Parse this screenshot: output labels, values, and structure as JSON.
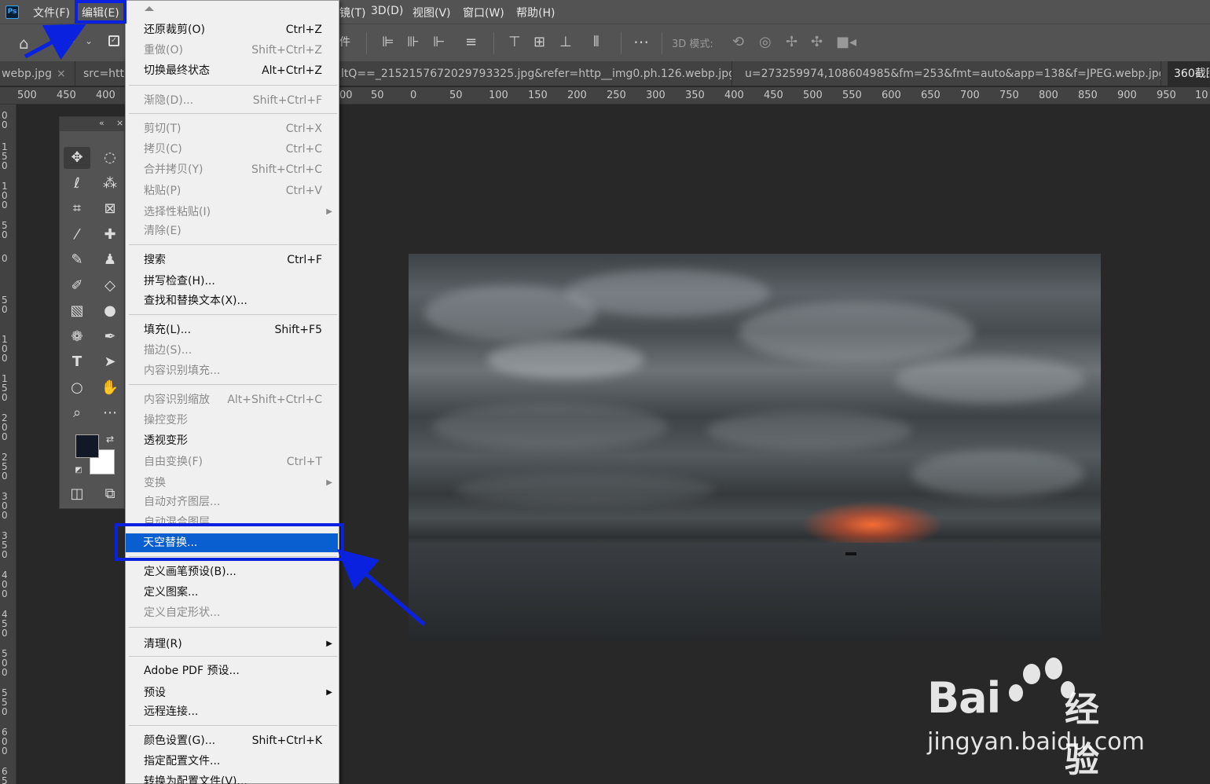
{
  "app": {
    "logo": "Ps"
  },
  "menubar": {
    "items": [
      {
        "label": "文件(F)"
      },
      {
        "label": "编辑(E)"
      },
      {
        "label": "镜(T)"
      },
      {
        "label": "3D(D)"
      },
      {
        "label": "视图(V)"
      },
      {
        "label": "窗口(W)"
      },
      {
        "label": "帮助(H)"
      }
    ]
  },
  "options": {
    "threed_label": "3D 模式:",
    "partial_label": "件"
  },
  "tabs": [
    {
      "label": "webp.jpg"
    },
    {
      "label": "src=http"
    },
    {
      "label": "ltQ==_2152157672029793325.jpg&refer=http__img0.ph.126.webp.jpg"
    },
    {
      "label": "u=273259974,108604985&fm=253&fmt=auto&app=138&f=JPEG.webp.jpg"
    },
    {
      "label": "360截图"
    }
  ],
  "tab_close": "×",
  "ruler": {
    "left_ticks": [
      "500",
      "450",
      "400"
    ],
    "right_ticks": [
      "00",
      "50",
      "0",
      "50",
      "100",
      "150",
      "200",
      "250",
      "300",
      "350",
      "400",
      "450",
      "500",
      "550",
      "600",
      "650",
      "700",
      "750",
      "800",
      "850",
      "900",
      "950",
      "10"
    ],
    "vertical_labels": [
      "0 0",
      "1 5 0",
      "1 0 0",
      "5 0",
      "0",
      "5 0",
      "1 0 0",
      "1 5 0",
      "2 0 0",
      "2 5 0",
      "3 0 0",
      "3 5 0",
      "4 0 0",
      "4 5 0",
      "5 0 0",
      "5 5 0",
      "6 0 0",
      "6 5"
    ]
  },
  "edit_menu": {
    "items": [
      {
        "label": "还原裁剪(O)",
        "shortcut": "Ctrl+Z",
        "disabled": false
      },
      {
        "label": "重做(O)",
        "shortcut": "Shift+Ctrl+Z",
        "disabled": true
      },
      {
        "label": "切换最终状态",
        "shortcut": "Alt+Ctrl+Z",
        "disabled": false
      },
      {
        "label": "渐隐(D)...",
        "shortcut": "Shift+Ctrl+F",
        "disabled": true
      },
      {
        "label": "剪切(T)",
        "shortcut": "Ctrl+X",
        "disabled": true
      },
      {
        "label": "拷贝(C)",
        "shortcut": "Ctrl+C",
        "disabled": true
      },
      {
        "label": "合并拷贝(Y)",
        "shortcut": "Shift+Ctrl+C",
        "disabled": true
      },
      {
        "label": "粘贴(P)",
        "shortcut": "Ctrl+V",
        "disabled": true
      },
      {
        "label": "选择性粘贴(I)",
        "shortcut": "",
        "disabled": true,
        "submenu": true
      },
      {
        "label": "清除(E)",
        "shortcut": "",
        "disabled": true
      },
      {
        "label": "搜索",
        "shortcut": "Ctrl+F",
        "disabled": false
      },
      {
        "label": "拼写检查(H)...",
        "shortcut": "",
        "disabled": false
      },
      {
        "label": "查找和替换文本(X)...",
        "shortcut": "",
        "disabled": false
      },
      {
        "label": "填充(L)...",
        "shortcut": "Shift+F5",
        "disabled": false
      },
      {
        "label": "描边(S)...",
        "shortcut": "",
        "disabled": true
      },
      {
        "label": "内容识别填充...",
        "shortcut": "",
        "disabled": true
      },
      {
        "label": "内容识别缩放",
        "shortcut": "Alt+Shift+Ctrl+C",
        "disabled": true
      },
      {
        "label": "操控变形",
        "shortcut": "",
        "disabled": true
      },
      {
        "label": "透视变形",
        "shortcut": "",
        "disabled": false
      },
      {
        "label": "自由变换(F)",
        "shortcut": "Ctrl+T",
        "disabled": true
      },
      {
        "label": "变换",
        "shortcut": "",
        "disabled": true,
        "submenu": true
      },
      {
        "label": "自动对齐图层...",
        "shortcut": "",
        "disabled": true
      },
      {
        "label": "自动混合图层...",
        "shortcut": "",
        "disabled": true
      },
      {
        "label": "天空替换...",
        "shortcut": "",
        "disabled": false,
        "highlighted": true
      },
      {
        "label": "定义画笔预设(B)...",
        "shortcut": "",
        "disabled": false
      },
      {
        "label": "定义图案...",
        "shortcut": "",
        "disabled": false
      },
      {
        "label": "定义自定形状...",
        "shortcut": "",
        "disabled": true
      },
      {
        "label": "清理(R)",
        "shortcut": "",
        "disabled": false,
        "submenu": true
      },
      {
        "label": "Adobe PDF 预设...",
        "shortcut": "",
        "disabled": false
      },
      {
        "label": "预设",
        "shortcut": "",
        "disabled": false,
        "submenu": true
      },
      {
        "label": "远程连接...",
        "shortcut": "",
        "disabled": false
      },
      {
        "label": "颜色设置(G)...",
        "shortcut": "Shift+Ctrl+K",
        "disabled": false
      },
      {
        "label": "指定配置文件...",
        "shortcut": "",
        "disabled": false
      },
      {
        "label": "转换为配置文件(V)...",
        "shortcut": "",
        "disabled": false
      }
    ]
  },
  "watermark": {
    "brand": "Bai",
    "brand_cn": "经验",
    "url": "jingyan.baidu.com"
  },
  "colors": {
    "highlight": "#0a5fd0",
    "annotation": "#0a22e0",
    "menubar": "#535353"
  }
}
